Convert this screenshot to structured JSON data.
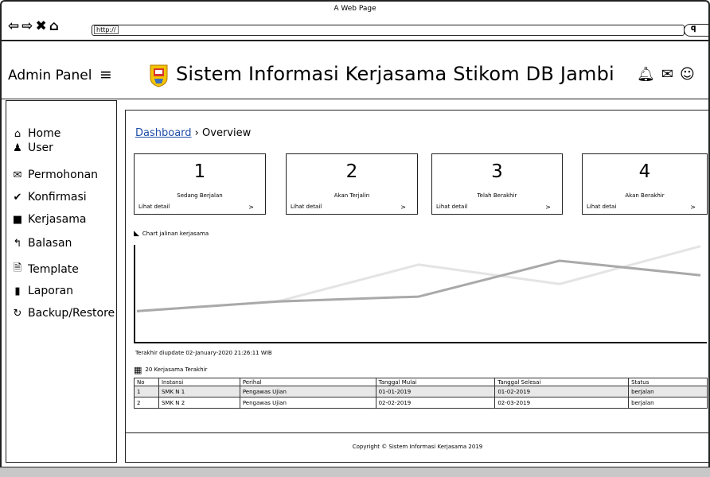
{
  "window": {
    "title": "A Web Page"
  },
  "browser": {
    "url_prefix": "http://",
    "nav_icons": [
      "back-icon",
      "forward-icon",
      "close-icon",
      "home-icon"
    ],
    "search_icon": "search-icon"
  },
  "header": {
    "admin_label": "Admin Panel",
    "menu_icon": "hamburger-icon",
    "app_title": "Sistem Informasi Kerjasama Stikom DB Jambi",
    "icons": [
      "bell-icon",
      "mail-icon",
      "user-circle-icon"
    ]
  },
  "sidebar": {
    "items": [
      {
        "label": "Home",
        "icon": "home-icon"
      },
      {
        "label": "User",
        "icon": "user-icon"
      },
      {
        "label": "Permohonan",
        "icon": "mail-icon"
      },
      {
        "label": "Konfirmasi",
        "icon": "check-icon"
      },
      {
        "label": "Kerjasama",
        "icon": "book-icon"
      },
      {
        "label": "Balasan",
        "icon": "reply-icon"
      },
      {
        "label": "Template",
        "icon": "word-doc-icon"
      },
      {
        "label": "Laporan",
        "icon": "notebook-icon"
      },
      {
        "label": "Backup/Restore",
        "icon": "refresh-icon"
      }
    ]
  },
  "breadcrumb": {
    "link": "Dashboard",
    "separator": "›",
    "current": "Overview"
  },
  "cards": [
    {
      "number": "1",
      "label": "Sedang Berjalan",
      "detail": "Lihat detail",
      "arrow": ">"
    },
    {
      "number": "2",
      "label": "Akan Terjalin",
      "detail": "Lihat detail",
      "arrow": ">"
    },
    {
      "number": "3",
      "label": "Telah Berakhir",
      "detail": "Lihat detail",
      "arrow": ">"
    },
    {
      "number": "4",
      "label": "Akan Berakhir",
      "detail": "Lihat detai",
      "arrow": ">"
    }
  ],
  "chart_section": {
    "label": "Chart jalinan kerjasama",
    "icon": "area-chart-icon"
  },
  "chart_data": {
    "type": "line",
    "title": "Chart jalinan kerjasama",
    "xlabel": "",
    "ylabel": "",
    "x": [
      0,
      1,
      2,
      3,
      4
    ],
    "ylim": [
      0,
      100
    ],
    "grid": false,
    "series": [
      {
        "values": [
          30,
          40,
          78,
          58,
          97
        ],
        "color": "#e4e4e4"
      },
      {
        "values": [
          30,
          40,
          45,
          82,
          67
        ],
        "color": "#a9a9a9"
      }
    ]
  },
  "updated_text": "Terakhir diupdate 02-January-2020 21:26:11 WIB",
  "table": {
    "caption": "20 Kerjasama Terakhir",
    "icon": "table-icon",
    "columns": [
      "No",
      "Instansi",
      "Perihal",
      "Tanggal Mulai",
      "Tanggal Selesai",
      "Status"
    ],
    "rows": [
      [
        "1",
        "SMK N 1",
        "Pengawas Ujian",
        "01-01-2019",
        "01-02-2019",
        "berjalan"
      ],
      [
        "2",
        "SMK N 2",
        "Pengawas Ujian",
        "02-02-2019",
        "02-03-2019",
        "berjalan"
      ]
    ]
  },
  "footer": {
    "text": "Copyright © Sistem Informasi Kerjasama 2019"
  }
}
